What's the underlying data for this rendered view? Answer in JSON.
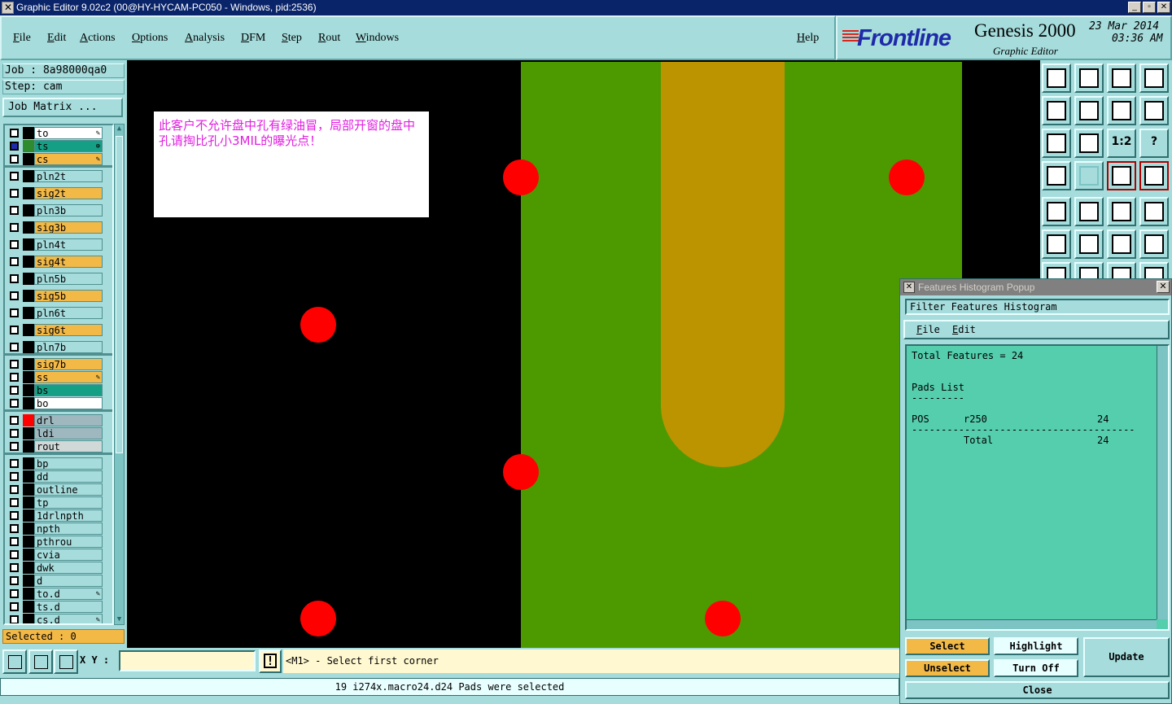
{
  "window": {
    "title": "Graphic Editor 9.02c2 (00@HY-HYCAM-PC050 - Windows, pid:2536)",
    "controls": [
      "_",
      "▫",
      "✕"
    ]
  },
  "menu": {
    "items": [
      "File",
      "Edit",
      "Actions",
      "Options",
      "Analysis",
      "DFM",
      "Step",
      "Rout",
      "Windows"
    ],
    "help": "Help"
  },
  "header": {
    "brand": "Frontline",
    "product": "Genesis 2000",
    "subtitle": "Graphic Editor",
    "date": "23 Mar 2014",
    "time": "03:36 AM"
  },
  "job": {
    "job_label": "Job : 8a98000qa0",
    "step_label": "Step: cam",
    "matrix_button": "Job Matrix ..."
  },
  "layers": [
    {
      "name": "to",
      "color": "#ffffff",
      "mark": "✎"
    },
    {
      "name": "ts",
      "color": "#15a085",
      "mark": "⊕",
      "swatch": "#2e8b2e",
      "check": "#1e2aa8"
    },
    {
      "name": "cs",
      "color": "#f3b947",
      "mark": "✎"
    },
    {
      "name": "pln2t",
      "color": "#a6dcdc"
    },
    {
      "name": "sig2t",
      "color": "#f3b947"
    },
    {
      "name": "pln3b",
      "color": "#a6dcdc"
    },
    {
      "name": "sig3b",
      "color": "#f3b947"
    },
    {
      "name": "pln4t",
      "color": "#a6dcdc"
    },
    {
      "name": "sig4t",
      "color": "#f3b947"
    },
    {
      "name": "pln5b",
      "color": "#a6dcdc"
    },
    {
      "name": "sig5b",
      "color": "#f3b947"
    },
    {
      "name": "pln6t",
      "color": "#a6dcdc"
    },
    {
      "name": "sig6t",
      "color": "#f3b947"
    },
    {
      "name": "pln7b",
      "color": "#a6dcdc"
    },
    {
      "name": "sig7b",
      "color": "#f3b947"
    },
    {
      "name": "ss",
      "color": "#f3b947",
      "mark": "✎"
    },
    {
      "name": "bs",
      "color": "#15a085"
    },
    {
      "name": "bo",
      "color": "#ffffff"
    },
    {
      "name": "drl",
      "color": "#9fb8c0",
      "swatch": "#ff0000"
    },
    {
      "name": "ldi",
      "color": "#9fb8c0"
    },
    {
      "name": "rout",
      "color": "#d0d8d8"
    },
    {
      "name": "bp",
      "color": "#a6dcdc"
    },
    {
      "name": "dd",
      "color": "#a6dcdc"
    },
    {
      "name": "outline",
      "color": "#a6dcdc"
    },
    {
      "name": "tp",
      "color": "#a6dcdc"
    },
    {
      "name": "1drlnpth",
      "color": "#a6dcdc"
    },
    {
      "name": "npth",
      "color": "#a6dcdc"
    },
    {
      "name": "pthrou",
      "color": "#a6dcdc"
    },
    {
      "name": "cvia",
      "color": "#a6dcdc"
    },
    {
      "name": "dwk",
      "color": "#a6dcdc"
    },
    {
      "name": "d",
      "color": "#a6dcdc"
    },
    {
      "name": "to.d",
      "color": "#a6dcdc",
      "mark": "✎"
    },
    {
      "name": "ts.d",
      "color": "#a6dcdc"
    },
    {
      "name": "cs.d",
      "color": "#a6dcdc",
      "mark": "✎"
    }
  ],
  "selected_label": "Selected : 0",
  "canvas": {
    "note": "此客户不允许盘中孔有绿油冒，局部开窗的盘中孔请掏比孔小3MIL的曝光点！"
  },
  "toolbar": {
    "scale_label": "1:2",
    "help_label": "?"
  },
  "histogram": {
    "title": "Features Histogram Popup",
    "filter_label": "Filter Features Histogram",
    "menu": [
      "File",
      "Edit"
    ],
    "total": "Total Features = 24",
    "section": "Pads List",
    "underline": "---------",
    "row_type": "POS",
    "row_symbol": "r250",
    "row_count": "24",
    "divider": "--------------------------------------",
    "total_label": "Total",
    "total_count": "24",
    "buttons": {
      "select": "Select",
      "unselect": "Unselect",
      "highlight": "Highlight",
      "turn_off": "Turn Off",
      "update": "Update",
      "close": "Close"
    }
  },
  "command": {
    "xy_label": "X Y :",
    "xy_value": "",
    "warn": "!",
    "prompt": "<M1> - Select first corner",
    "status": "19 i274x.macro24.d24 Pads were selected"
  }
}
